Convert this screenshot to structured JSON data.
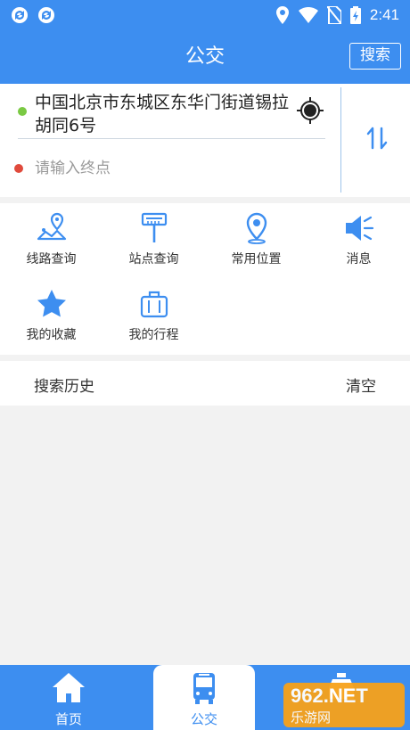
{
  "status_bar": {
    "time": "2:41",
    "left_icons": [
      "sync-icon",
      "sync-icon"
    ],
    "right_icons": [
      "location-icon",
      "wifi-icon",
      "no-sim-icon",
      "battery-charging-icon"
    ]
  },
  "header": {
    "title": "公交",
    "search_label": "搜索",
    "color": "#3d8ef0"
  },
  "route": {
    "start_value": "中国北京市东城区东华门街道锡拉胡同6号",
    "end_placeholder": "请输入终点",
    "start_dot_color": "#7ac943",
    "end_dot_color": "#e04a3c",
    "locate_icon": "locate-icon",
    "swap_icon": "swap-icon"
  },
  "menu": {
    "items": [
      {
        "label": "线路查询",
        "icon": "route-map-icon"
      },
      {
        "label": "站点查询",
        "icon": "bus-stop-icon"
      },
      {
        "label": "常用位置",
        "icon": "location-pin-icon"
      },
      {
        "label": "消息",
        "icon": "megaphone-icon"
      },
      {
        "label": "我的收藏",
        "icon": "star-icon"
      },
      {
        "label": "我的行程",
        "icon": "briefcase-icon"
      }
    ]
  },
  "history": {
    "title": "搜索历史",
    "clear_label": "清空"
  },
  "bottom_nav": {
    "items": [
      {
        "label": "首页",
        "icon": "home-icon",
        "active": false
      },
      {
        "label": "公交",
        "icon": "bus-icon",
        "active": true
      },
      {
        "label": "",
        "icon": "taxi-icon",
        "active": false
      }
    ]
  },
  "watermark": {
    "top": "962.NET",
    "bottom": "乐游网"
  }
}
